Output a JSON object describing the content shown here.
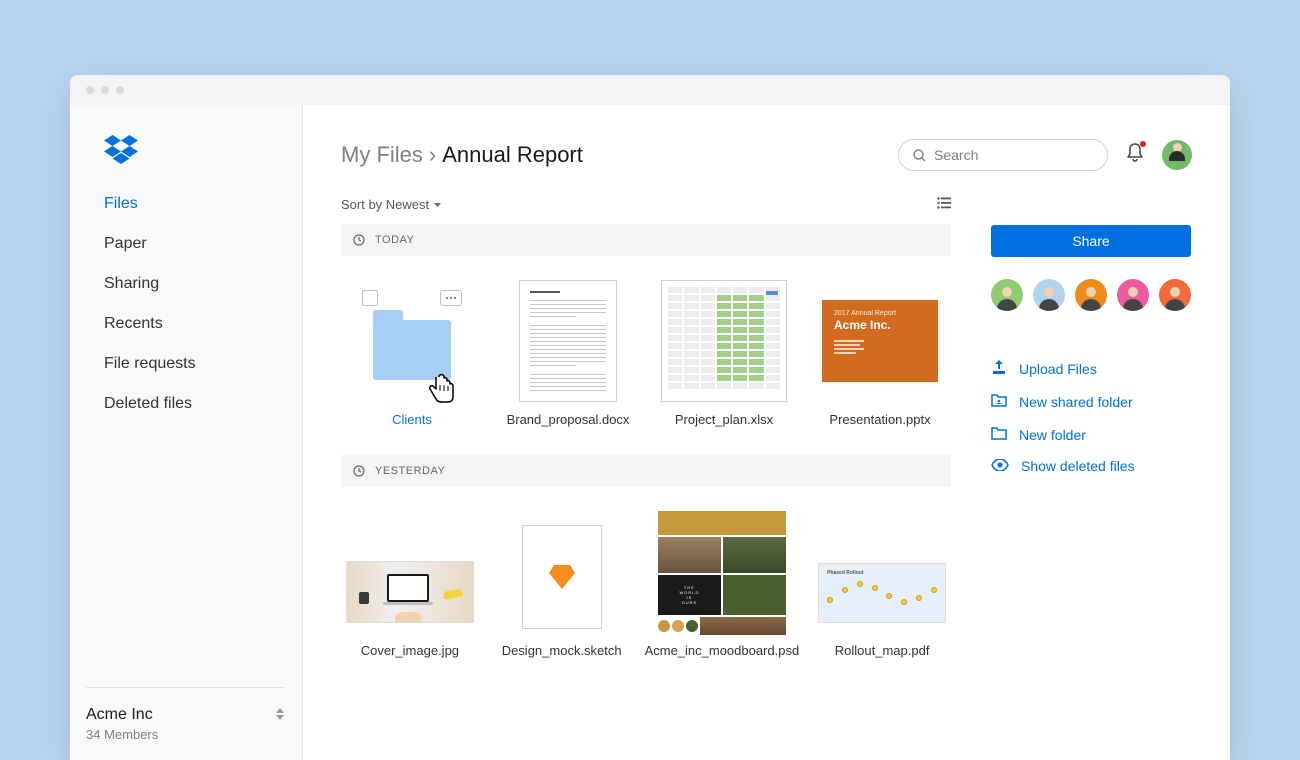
{
  "sidebar": {
    "nav": [
      {
        "label": "Files",
        "active": true
      },
      {
        "label": "Paper",
        "active": false
      },
      {
        "label": "Sharing",
        "active": false
      },
      {
        "label": "Recents",
        "active": false
      },
      {
        "label": "File requests",
        "active": false
      },
      {
        "label": "Deleted files",
        "active": false
      }
    ],
    "team_name": "Acme Inc",
    "team_members": "34 Members"
  },
  "header": {
    "breadcrumb_root": "My Files",
    "breadcrumb_current": "Annual Report",
    "search_placeholder": "Search"
  },
  "sort": {
    "label": "Sort by Newest"
  },
  "sections": {
    "today": "TODAY",
    "yesterday": "YESTERDAY"
  },
  "files_today": [
    {
      "name": "Clients",
      "type": "folder",
      "hovered": true
    },
    {
      "name": "Brand_proposal.docx",
      "type": "doc"
    },
    {
      "name": "Project_plan.xlsx",
      "type": "xls"
    },
    {
      "name": "Presentation.pptx",
      "type": "ppt"
    }
  ],
  "files_yesterday": [
    {
      "name": "Cover_image.jpg",
      "type": "cover"
    },
    {
      "name": "Design_mock.sketch",
      "type": "sketch"
    },
    {
      "name": "Acme_inc_moodboard.psd",
      "type": "mood"
    },
    {
      "name": "Rollout_map.pdf",
      "type": "map"
    }
  ],
  "ppt_preview": {
    "year": "2017 Annual Report",
    "title": "Acme Inc."
  },
  "moodboard_text": "THE WORLD IS OURS",
  "rollout_title": "Phased Rollout",
  "right": {
    "share_label": "Share",
    "avatar_colors": [
      "#8fcc6f",
      "#b2d3ef",
      "#ee8b1a",
      "#ec5ba1",
      "#f06a3a"
    ],
    "actions": [
      {
        "label": "Upload Files",
        "icon": "upload"
      },
      {
        "label": "New shared folder",
        "icon": "shared-folder"
      },
      {
        "label": "New folder",
        "icon": "folder"
      },
      {
        "label": "Show deleted files",
        "icon": "eye"
      }
    ]
  }
}
